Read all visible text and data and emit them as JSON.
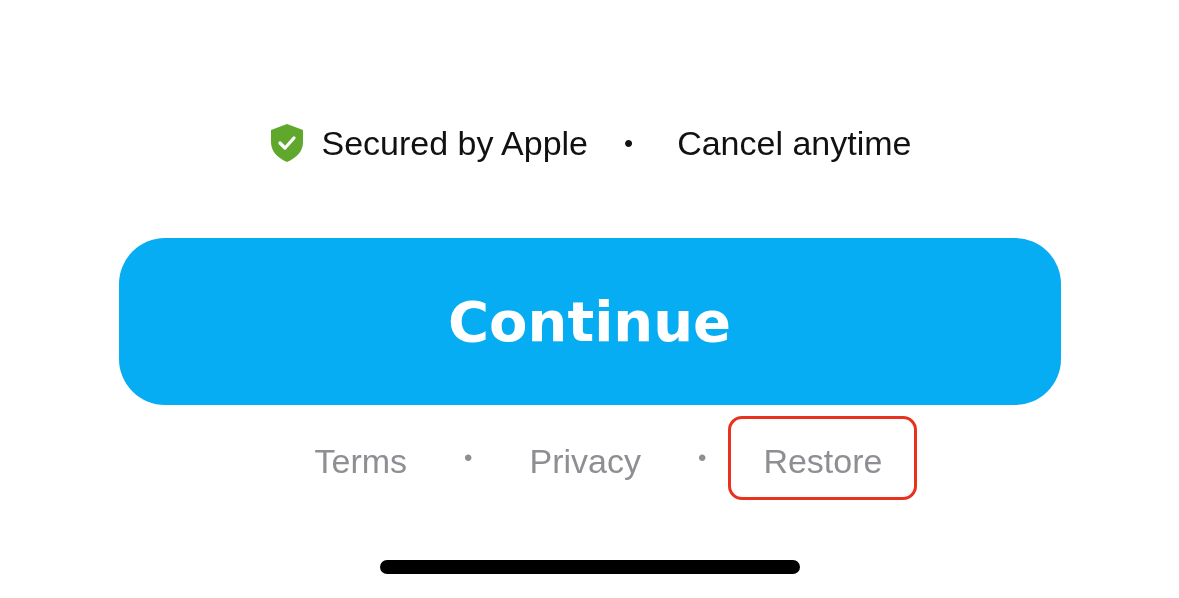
{
  "trust_row": [
    {
      "kind": "badge",
      "text": "Secured by Apple"
    },
    {
      "kind": "dot",
      "text": "•"
    },
    {
      "kind": "text",
      "text": "Cancel anytime"
    }
  ],
  "continue_button": {
    "label": "Continue"
  },
  "footer": [
    {
      "kind": "link",
      "text": "Terms",
      "highlighted": false
    },
    {
      "kind": "dot",
      "text": "•"
    },
    {
      "kind": "link",
      "text": "Privacy",
      "highlighted": false
    },
    {
      "kind": "dot",
      "text": "•"
    },
    {
      "kind": "link",
      "text": "Restore",
      "highlighted": true
    }
  ]
}
